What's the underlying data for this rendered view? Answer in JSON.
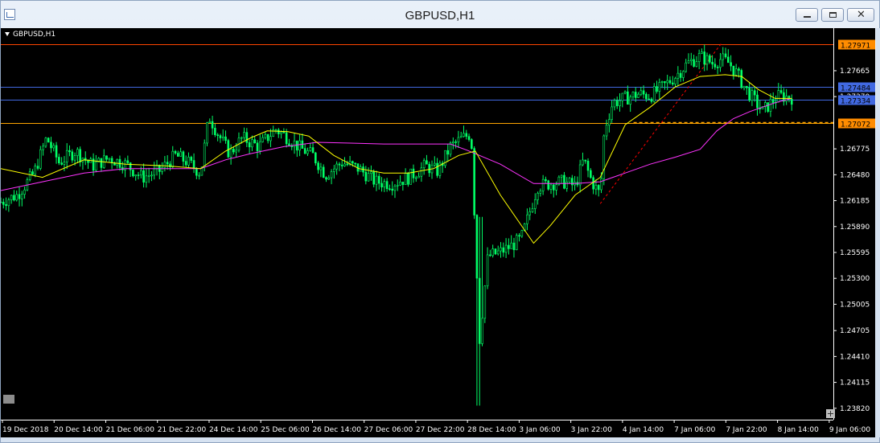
{
  "window": {
    "title": "GBPUSD,H1",
    "controls": {
      "minimize": "minimize-icon",
      "maximize": "maximize-icon",
      "close": "close-icon",
      "close_glyph": "✕"
    }
  },
  "chart_data": {
    "type": "candlestick",
    "symbol_label": "GBPUSD,H1",
    "colors": {
      "background": "#000000",
      "bull": "#00ff66",
      "bear": "#00ff66",
      "axis_text": "#ffffff",
      "ma_fast": "#ffff00",
      "ma_slow": "#ff33ff",
      "trendline": "#ff0000"
    },
    "ylim": [
      1.2369,
      1.2815
    ],
    "y_ticks": [
      "1.27665",
      "1.27370",
      "1.26775",
      "1.26480",
      "1.26185",
      "1.25890",
      "1.25595",
      "1.25300",
      "1.25005",
      "1.24705",
      "1.24410",
      "1.24115",
      "1.23820"
    ],
    "x_ticks": [
      "19 Dec 2018",
      "20 Dec 14:00",
      "21 Dec 06:00",
      "21 Dec 22:00",
      "24 Dec 14:00",
      "25 Dec 06:00",
      "26 Dec 14:00",
      "27 Dec 06:00",
      "27 Dec 22:00",
      "28 Dec 14:00",
      "3 Jan 06:00",
      "3 Jan 22:00",
      "4 Jan 14:00",
      "7 Jan 06:00",
      "7 Jan 22:00",
      "8 Jan 14:00",
      "9 Jan 06:00"
    ],
    "levels": [
      {
        "price": 1.27971,
        "label": "1.27971",
        "color": "#ff4500",
        "label_bg": "#ff8c00",
        "style": "solid"
      },
      {
        "price": 1.27484,
        "label": "1.27484",
        "color": "#4169e1",
        "label_bg": "#4169e1",
        "style": "solid"
      },
      {
        "price": 1.27334,
        "label": "1.27334",
        "color": "#4169e1",
        "label_bg": "#4169e1",
        "style": "solid"
      },
      {
        "price": 1.27072,
        "label": "1.27072",
        "color": "#ffa500",
        "label_bg": "#ff8c00",
        "style": "solid"
      }
    ],
    "short_dashed_level": {
      "price": 1.27075,
      "color": "#ffa500"
    },
    "trendline": {
      "from": {
        "t": 0.72,
        "price": 1.2615
      },
      "to": {
        "t": 0.865,
        "price": 1.2797
      }
    },
    "close_path": [
      [
        0.0,
        1.2617
      ],
      [
        0.02,
        1.2625
      ],
      [
        0.04,
        1.265
      ],
      [
        0.055,
        1.269
      ],
      [
        0.07,
        1.2662
      ],
      [
        0.09,
        1.2675
      ],
      [
        0.11,
        1.2658
      ],
      [
        0.13,
        1.2667
      ],
      [
        0.15,
        1.266
      ],
      [
        0.17,
        1.2645
      ],
      [
        0.19,
        1.2652
      ],
      [
        0.21,
        1.267
      ],
      [
        0.225,
        1.2662
      ],
      [
        0.24,
        1.265
      ],
      [
        0.25,
        1.2715
      ],
      [
        0.26,
        1.2696
      ],
      [
        0.275,
        1.2672
      ],
      [
        0.29,
        1.269
      ],
      [
        0.31,
        1.268
      ],
      [
        0.33,
        1.27
      ],
      [
        0.345,
        1.269
      ],
      [
        0.36,
        1.2678
      ],
      [
        0.375,
        1.267
      ],
      [
        0.39,
        1.2648
      ],
      [
        0.41,
        1.2662
      ],
      [
        0.43,
        1.2655
      ],
      [
        0.45,
        1.264
      ],
      [
        0.47,
        1.2638
      ],
      [
        0.49,
        1.2645
      ],
      [
        0.51,
        1.2658
      ],
      [
        0.525,
        1.2652
      ],
      [
        0.54,
        1.268
      ],
      [
        0.555,
        1.269
      ],
      [
        0.565,
        1.2695
      ],
      [
        0.575,
        1.246
      ],
      [
        0.585,
        1.2555
      ],
      [
        0.6,
        1.256
      ],
      [
        0.615,
        1.2568
      ],
      [
        0.625,
        1.2575
      ],
      [
        0.635,
        1.2605
      ],
      [
        0.645,
        1.2635
      ],
      [
        0.66,
        1.2638
      ],
      [
        0.675,
        1.264
      ],
      [
        0.69,
        1.2635
      ],
      [
        0.7,
        1.2665
      ],
      [
        0.71,
        1.264
      ],
      [
        0.72,
        1.2625
      ],
      [
        0.725,
        1.27
      ],
      [
        0.735,
        1.273
      ],
      [
        0.75,
        1.2735
      ],
      [
        0.765,
        1.274
      ],
      [
        0.78,
        1.2738
      ],
      [
        0.795,
        1.2748
      ],
      [
        0.81,
        1.276
      ],
      [
        0.825,
        1.2775
      ],
      [
        0.84,
        1.2783
      ],
      [
        0.855,
        1.2775
      ],
      [
        0.865,
        1.278
      ],
      [
        0.875,
        1.2775
      ],
      [
        0.885,
        1.2762
      ],
      [
        0.895,
        1.2745
      ],
      [
        0.905,
        1.2733
      ],
      [
        0.915,
        1.272
      ],
      [
        0.925,
        1.273
      ],
      [
        0.935,
        1.2738
      ],
      [
        0.95,
        1.2736
      ]
    ],
    "ma_fast": [
      [
        0.0,
        1.2655
      ],
      [
        0.05,
        1.2645
      ],
      [
        0.1,
        1.2665
      ],
      [
        0.15,
        1.266
      ],
      [
        0.2,
        1.2658
      ],
      [
        0.24,
        1.2655
      ],
      [
        0.27,
        1.2675
      ],
      [
        0.3,
        1.269
      ],
      [
        0.32,
        1.2698
      ],
      [
        0.345,
        1.2697
      ],
      [
        0.37,
        1.2692
      ],
      [
        0.4,
        1.267
      ],
      [
        0.43,
        1.2655
      ],
      [
        0.46,
        1.265
      ],
      [
        0.49,
        1.265
      ],
      [
        0.52,
        1.2655
      ],
      [
        0.55,
        1.267
      ],
      [
        0.57,
        1.2675
      ],
      [
        0.6,
        1.2625
      ],
      [
        0.64,
        1.257
      ],
      [
        0.66,
        1.259
      ],
      [
        0.69,
        1.2625
      ],
      [
        0.72,
        1.2645
      ],
      [
        0.75,
        1.2705
      ],
      [
        0.78,
        1.2725
      ],
      [
        0.81,
        1.2748
      ],
      [
        0.84,
        1.276
      ],
      [
        0.87,
        1.2762
      ],
      [
        0.89,
        1.276
      ],
      [
        0.91,
        1.2745
      ],
      [
        0.93,
        1.2735
      ],
      [
        0.95,
        1.2735
      ]
    ],
    "ma_slow": [
      [
        0.0,
        1.263
      ],
      [
        0.05,
        1.264
      ],
      [
        0.1,
        1.265
      ],
      [
        0.15,
        1.2655
      ],
      [
        0.2,
        1.2655
      ],
      [
        0.24,
        1.2655
      ],
      [
        0.27,
        1.2665
      ],
      [
        0.3,
        1.2672
      ],
      [
        0.34,
        1.268
      ],
      [
        0.38,
        1.2685
      ],
      [
        0.42,
        1.2684
      ],
      [
        0.46,
        1.2683
      ],
      [
        0.5,
        1.2683
      ],
      [
        0.54,
        1.2683
      ],
      [
        0.56,
        1.2676
      ],
      [
        0.6,
        1.266
      ],
      [
        0.64,
        1.2638
      ],
      [
        0.66,
        1.2638
      ],
      [
        0.69,
        1.2638
      ],
      [
        0.72,
        1.264
      ],
      [
        0.75,
        1.265
      ],
      [
        0.78,
        1.266
      ],
      [
        0.81,
        1.2668
      ],
      [
        0.84,
        1.2677
      ],
      [
        0.86,
        1.2698
      ],
      [
        0.88,
        1.2712
      ],
      [
        0.9,
        1.272
      ],
      [
        0.93,
        1.273
      ],
      [
        0.95,
        1.2735
      ]
    ]
  }
}
